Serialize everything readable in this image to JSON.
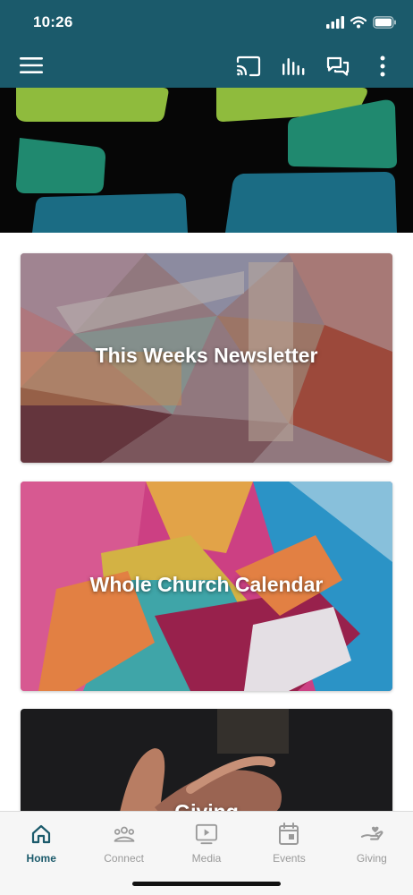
{
  "status_bar": {
    "time": "10:26"
  },
  "colors": {
    "brand": "#1b5a6b",
    "tab_inactive": "#9a9a9a"
  },
  "app_bar": {
    "menu_icon": "hamburger-menu-icon",
    "actions": [
      "cast-icon",
      "audio-bars-icon",
      "chat-icon",
      "more-vertical-icon"
    ]
  },
  "cards": [
    {
      "title": "This Weeks Newsletter"
    },
    {
      "title": "Whole Church Calendar"
    },
    {
      "title": "Giving"
    }
  ],
  "bottom_nav": {
    "active": "Home",
    "tabs": [
      {
        "label": "Home",
        "icon": "home-icon"
      },
      {
        "label": "Connect",
        "icon": "people-icon"
      },
      {
        "label": "Media",
        "icon": "media-play-icon"
      },
      {
        "label": "Events",
        "icon": "calendar-icon"
      },
      {
        "label": "Giving",
        "icon": "giving-hand-icon"
      }
    ]
  }
}
